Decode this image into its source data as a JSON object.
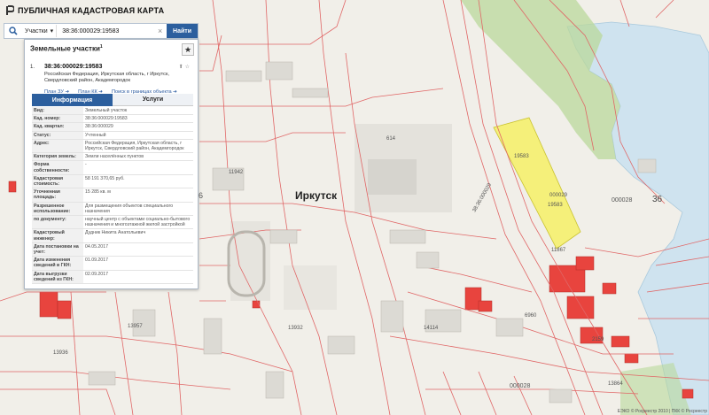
{
  "app": {
    "title": "ПУБЛИЧНАЯ КАДАСТРОВАЯ КАРТА"
  },
  "search": {
    "type_label": "Участки",
    "query": "38:36:000029:19583",
    "button_label": "Найти"
  },
  "panel": {
    "title": "Земельные участки",
    "title_sup": "1",
    "result": {
      "index": "1.",
      "cad_number": "38:36:000029:19583",
      "address": "Российская Федерация, Иркутская область, г Иркутск, Свердловский район, Академгородок",
      "links": [
        "План ЗУ",
        "План КК",
        "Поиск в границах объекта"
      ]
    },
    "tabs": [
      "Информация",
      "Услуги"
    ],
    "rows": [
      {
        "k": "Вид:",
        "v": "Земельный участок"
      },
      {
        "k": "Кад. номер:",
        "v": "38:36:000029:19583"
      },
      {
        "k": "Кад. квартал:",
        "v": "38:36:000029"
      },
      {
        "k": "Статус:",
        "v": "Учтенный"
      },
      {
        "k": "Адрес:",
        "v": "Российская Федерация, Иркутская область, г Иркутск, Свердловский район, Академгородок"
      },
      {
        "k": "Категория земель:",
        "v": "Земли населённых пунктов"
      },
      {
        "k": "Форма собственности:",
        "v": "-"
      },
      {
        "k": "Кадастровая стоимость:",
        "v": "58 191 370,65 руб."
      },
      {
        "k": "Уточненная площадь:",
        "v": "15 285 кв. м"
      },
      {
        "k": "Разрешенное использование:",
        "v": "Для размещения объектов специального назначения"
      },
      {
        "k": "по документу:",
        "v": "научный центр с объектами социально-бытового назначения и многоэтажной жилой застройкой"
      },
      {
        "k": "Кадастровый инженер:",
        "v": "Дудник Никита Анатольевич"
      },
      {
        "k": "Дата постановки на учет:",
        "v": "04.05.2017"
      },
      {
        "k": "Дата изменения сведений в ГКН:",
        "v": "01.09.2017"
      },
      {
        "k": "Дата выгрузки сведений из ГКН:",
        "v": "02.09.2017"
      }
    ]
  },
  "map": {
    "city": "Иркутск",
    "labels": [
      "614",
      "19583",
      "000029",
      "19583",
      "000028",
      "36",
      "11867",
      "11942",
      "13936",
      "000028",
      "14114",
      "13932",
      "13957",
      "6",
      "6960",
      "2159",
      "13864",
      "38:36:000029"
    ],
    "footer": "ЕЭКО © Росреестр 2010 | ПКК © Росреестр"
  },
  "colors": {
    "parcel_line": "#e06666",
    "highlight": "#f5f07a",
    "water": "#cfe3ef",
    "green": "#b9d89b",
    "building": "#e8443e",
    "accent": "#2c5f9e"
  }
}
